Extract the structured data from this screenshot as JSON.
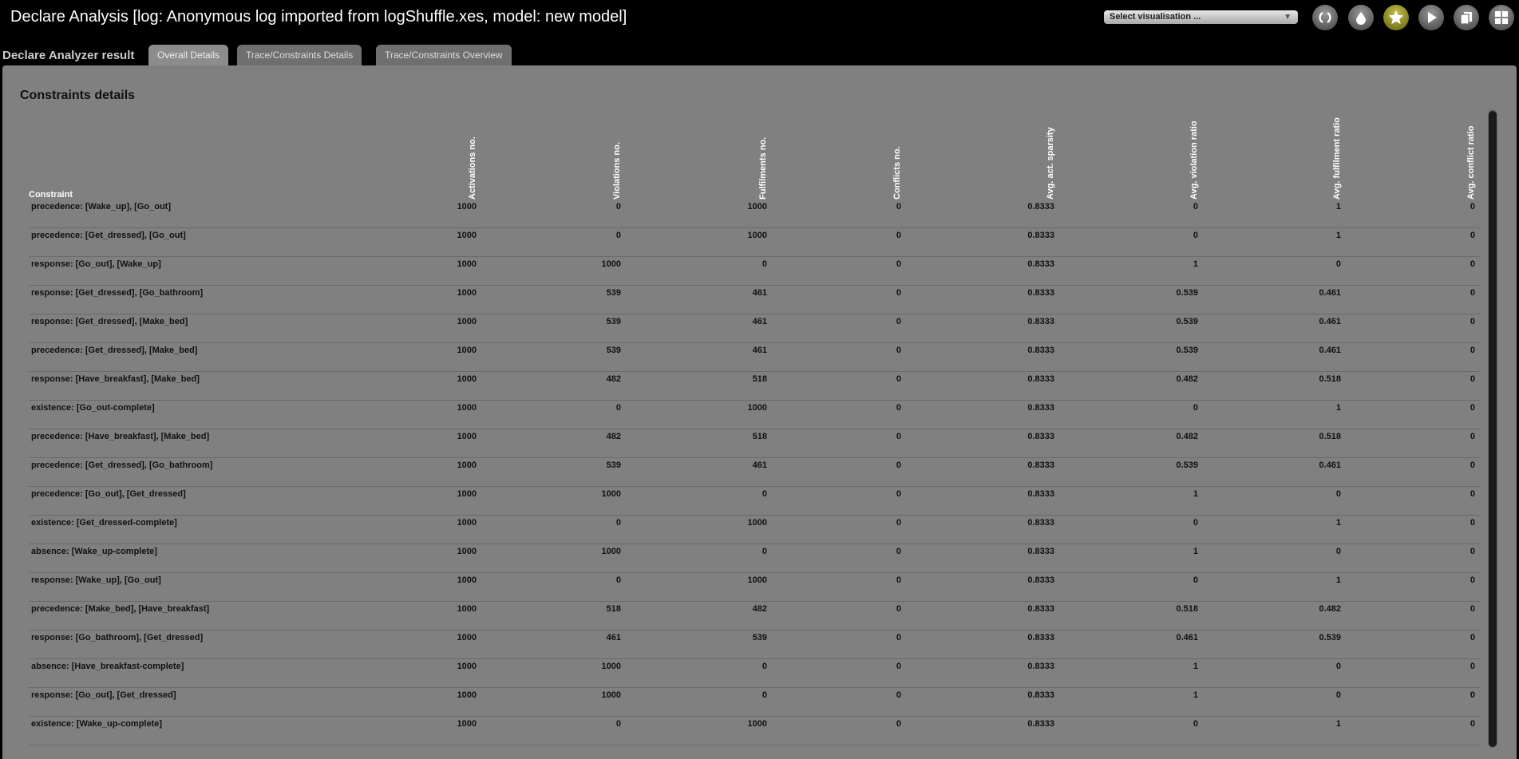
{
  "window": {
    "title": "Declare Analysis [log: Anonymous log imported from logShuffle.xes, model: new model]"
  },
  "toolbar": {
    "visualisation_select": "Select visualisation ...",
    "buttons": [
      {
        "icon": "refresh-icon"
      },
      {
        "icon": "drop-icon"
      },
      {
        "icon": "star-icon",
        "active": true
      },
      {
        "icon": "play-icon"
      },
      {
        "icon": "copy-icon"
      },
      {
        "icon": "grid-icon"
      }
    ]
  },
  "result_label": "Declare Analyzer result",
  "tabs": [
    {
      "label": "Overall Details",
      "active": true
    },
    {
      "label": "Trace/Constraints Details",
      "active": false
    },
    {
      "label": "Trace/Constraints Overview",
      "active": false
    }
  ],
  "section_title": "Constraints details",
  "table": {
    "columns": [
      "Constraint",
      "Activations no.",
      "Violations no.",
      "Fulfilments no.",
      "Conflicts no.",
      "Avg. act. sparsity",
      "Avg. violation ratio",
      "Avg. fulfilment ratio",
      "Avg. conflict ratio"
    ],
    "rows": [
      [
        "precedence: [Wake_up], [Go_out]",
        "1000",
        "0",
        "1000",
        "0",
        "0.8333",
        "0",
        "1",
        "0"
      ],
      [
        "precedence: [Get_dressed], [Go_out]",
        "1000",
        "0",
        "1000",
        "0",
        "0.8333",
        "0",
        "1",
        "0"
      ],
      [
        "response: [Go_out], [Wake_up]",
        "1000",
        "1000",
        "0",
        "0",
        "0.8333",
        "1",
        "0",
        "0"
      ],
      [
        "response: [Get_dressed], [Go_bathroom]",
        "1000",
        "539",
        "461",
        "0",
        "0.8333",
        "0.539",
        "0.461",
        "0"
      ],
      [
        "response: [Get_dressed], [Make_bed]",
        "1000",
        "539",
        "461",
        "0",
        "0.8333",
        "0.539",
        "0.461",
        "0"
      ],
      [
        "precedence: [Get_dressed], [Make_bed]",
        "1000",
        "539",
        "461",
        "0",
        "0.8333",
        "0.539",
        "0.461",
        "0"
      ],
      [
        "response: [Have_breakfast], [Make_bed]",
        "1000",
        "482",
        "518",
        "0",
        "0.8333",
        "0.482",
        "0.518",
        "0"
      ],
      [
        "existence: [Go_out-complete]",
        "1000",
        "0",
        "1000",
        "0",
        "0.8333",
        "0",
        "1",
        "0"
      ],
      [
        "precedence: [Have_breakfast], [Make_bed]",
        "1000",
        "482",
        "518",
        "0",
        "0.8333",
        "0.482",
        "0.518",
        "0"
      ],
      [
        "precedence: [Get_dressed], [Go_bathroom]",
        "1000",
        "539",
        "461",
        "0",
        "0.8333",
        "0.539",
        "0.461",
        "0"
      ],
      [
        "precedence: [Go_out], [Get_dressed]",
        "1000",
        "1000",
        "0",
        "0",
        "0.8333",
        "1",
        "0",
        "0"
      ],
      [
        "existence: [Get_dressed-complete]",
        "1000",
        "0",
        "1000",
        "0",
        "0.8333",
        "0",
        "1",
        "0"
      ],
      [
        "absence: [Wake_up-complete]",
        "1000",
        "1000",
        "0",
        "0",
        "0.8333",
        "1",
        "0",
        "0"
      ],
      [
        "response: [Wake_up], [Go_out]",
        "1000",
        "0",
        "1000",
        "0",
        "0.8333",
        "0",
        "1",
        "0"
      ],
      [
        "precedence: [Make_bed], [Have_breakfast]",
        "1000",
        "518",
        "482",
        "0",
        "0.8333",
        "0.518",
        "0.482",
        "0"
      ],
      [
        "response: [Go_bathroom], [Get_dressed]",
        "1000",
        "461",
        "539",
        "0",
        "0.8333",
        "0.461",
        "0.539",
        "0"
      ],
      [
        "absence: [Have_breakfast-complete]",
        "1000",
        "1000",
        "0",
        "0",
        "0.8333",
        "1",
        "0",
        "0"
      ],
      [
        "response: [Go_out], [Get_dressed]",
        "1000",
        "1000",
        "0",
        "0",
        "0.8333",
        "1",
        "0",
        "0"
      ],
      [
        "existence: [Wake_up-complete]",
        "1000",
        "0",
        "1000",
        "0",
        "0.8333",
        "0",
        "1",
        "0"
      ]
    ]
  },
  "colors": {
    "background": "#000000",
    "panel": "#808080",
    "accent_active": "#a8a332"
  }
}
